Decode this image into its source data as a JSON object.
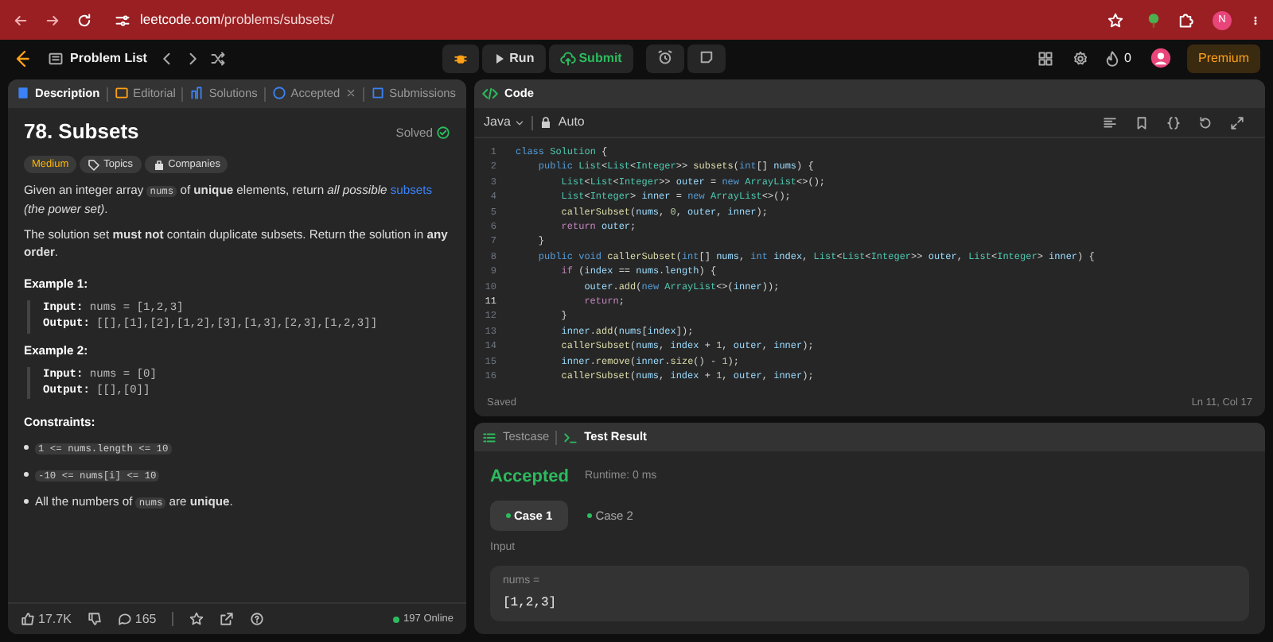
{
  "browser": {
    "url_domain": "leetcode.com",
    "url_path": "/problems/subsets/",
    "profile_initial": "N"
  },
  "nav": {
    "problem_list": "Problem List",
    "run": "Run",
    "submit": "Submit",
    "streak": "0",
    "premium": "Premium"
  },
  "description_tabs": [
    {
      "label": "Description",
      "selected": true,
      "closable": false
    },
    {
      "label": "Editorial",
      "selected": false,
      "closable": false
    },
    {
      "label": "Solutions",
      "selected": false,
      "closable": false
    },
    {
      "label": "Accepted",
      "selected": false,
      "closable": true
    },
    {
      "label": "Submissions",
      "selected": false,
      "closable": false
    }
  ],
  "problem": {
    "title": "78. Subsets",
    "status": "Solved",
    "difficulty": "Medium",
    "tags": [
      "Topics",
      "Companies"
    ],
    "paragraphs": [
      [
        {
          "kind": "text",
          "text": "Given an integer array "
        },
        {
          "kind": "code",
          "text": "nums"
        },
        {
          "kind": "text",
          "text": " of **unique** elements, return *all possible* "
        },
        {
          "kind": "link",
          "text": "subsets"
        },
        {
          "kind": "text",
          "text": " *(the power set)*."
        }
      ],
      [
        {
          "kind": "text",
          "text": "The solution set **must not** contain duplicate subsets. Return the solution in **any order**."
        }
      ]
    ],
    "examples": [
      {
        "title": "Example 1:",
        "lines": [
          {
            "label": "Input:",
            "value": "nums = [1,2,3]"
          },
          {
            "label": "Output:",
            "value": "[[],[1],[2],[1,2],[3],[1,3],[2,3],[1,2,3]]"
          }
        ]
      },
      {
        "title": "Example 2:",
        "lines": [
          {
            "label": "Input:",
            "value": "nums = [0]"
          },
          {
            "label": "Output:",
            "value": "[[],[0]]"
          }
        ]
      }
    ],
    "constraints_title": "Constraints:",
    "constraints": [
      [
        {
          "kind": "code",
          "text": "1 <= nums.length <= 10"
        }
      ],
      [
        {
          "kind": "code",
          "text": "-10 <= nums[i] <= 10"
        }
      ],
      [
        {
          "kind": "text",
          "text": "All the numbers of "
        },
        {
          "kind": "code",
          "text": "nums"
        },
        {
          "kind": "text",
          "text": " are **unique**."
        }
      ]
    ]
  },
  "footer": {
    "likes": "17.7K",
    "comments": "165",
    "online": "197 Online"
  },
  "code_panel": {
    "title": "Code",
    "language": "Java",
    "mode": "Auto",
    "status": "Saved",
    "cursor": "Ln 11, Col 17",
    "lines": [
      {
        "num": "1",
        "active": false,
        "tokens": [
          {
            "kind": "kw",
            "text": "class "
          },
          {
            "kind": "type",
            "text": "Solution"
          },
          {
            "kind": "p",
            "text": " {"
          }
        ]
      },
      {
        "num": "2",
        "active": false,
        "tokens": [
          {
            "kind": "kw",
            "text": "    public "
          },
          {
            "kind": "type",
            "text": "List"
          },
          {
            "kind": "p",
            "text": "<"
          },
          {
            "kind": "type",
            "text": "List"
          },
          {
            "kind": "p",
            "text": "<"
          },
          {
            "kind": "type",
            "text": "Integer"
          },
          {
            "kind": "p",
            "text": ">> "
          },
          {
            "kind": "fn",
            "text": "subsets"
          },
          {
            "kind": "p",
            "text": "("
          },
          {
            "kind": "kw",
            "text": "int"
          },
          {
            "kind": "p",
            "text": "[] "
          },
          {
            "kind": "var",
            "text": "nums"
          },
          {
            "kind": "p",
            "text": ") {"
          }
        ]
      },
      {
        "num": "3",
        "active": false,
        "tokens": [
          {
            "kind": "type",
            "text": "        List"
          },
          {
            "kind": "p",
            "text": "<"
          },
          {
            "kind": "type",
            "text": "List"
          },
          {
            "kind": "p",
            "text": "<"
          },
          {
            "kind": "type",
            "text": "Integer"
          },
          {
            "kind": "p",
            "text": ">> "
          },
          {
            "kind": "var",
            "text": "outer"
          },
          {
            "kind": "p",
            "text": " = "
          },
          {
            "kind": "kw",
            "text": "new "
          },
          {
            "kind": "type",
            "text": "ArrayList"
          },
          {
            "kind": "p",
            "text": "<>();"
          }
        ]
      },
      {
        "num": "4",
        "active": false,
        "tokens": [
          {
            "kind": "type",
            "text": "        List"
          },
          {
            "kind": "p",
            "text": "<"
          },
          {
            "kind": "type",
            "text": "Integer"
          },
          {
            "kind": "p",
            "text": "> "
          },
          {
            "kind": "var",
            "text": "inner"
          },
          {
            "kind": "p",
            "text": " = "
          },
          {
            "kind": "kw",
            "text": "new "
          },
          {
            "kind": "type",
            "text": "ArrayList"
          },
          {
            "kind": "p",
            "text": "<>();"
          }
        ]
      },
      {
        "num": "5",
        "active": false,
        "tokens": [
          {
            "kind": "fn",
            "text": "        callerSubset"
          },
          {
            "kind": "p",
            "text": "("
          },
          {
            "kind": "var",
            "text": "nums"
          },
          {
            "kind": "p",
            "text": ", "
          },
          {
            "kind": "num",
            "text": "0"
          },
          {
            "kind": "p",
            "text": ", "
          },
          {
            "kind": "var",
            "text": "outer"
          },
          {
            "kind": "p",
            "text": ", "
          },
          {
            "kind": "var",
            "text": "inner"
          },
          {
            "kind": "p",
            "text": ");"
          }
        ]
      },
      {
        "num": "6",
        "active": false,
        "tokens": [
          {
            "kind": "ctrl",
            "text": "        return "
          },
          {
            "kind": "var",
            "text": "outer"
          },
          {
            "kind": "p",
            "text": ";"
          }
        ]
      },
      {
        "num": "7",
        "active": false,
        "tokens": [
          {
            "kind": "p",
            "text": "    }"
          }
        ]
      },
      {
        "num": "8",
        "active": false,
        "tokens": [
          {
            "kind": "kw",
            "text": "    public void "
          },
          {
            "kind": "fn",
            "text": "callerSubset"
          },
          {
            "kind": "p",
            "text": "("
          },
          {
            "kind": "kw",
            "text": "int"
          },
          {
            "kind": "p",
            "text": "[] "
          },
          {
            "kind": "var",
            "text": "nums"
          },
          {
            "kind": "p",
            "text": ", "
          },
          {
            "kind": "kw",
            "text": "int "
          },
          {
            "kind": "var",
            "text": "index"
          },
          {
            "kind": "p",
            "text": ", "
          },
          {
            "kind": "type",
            "text": "List"
          },
          {
            "kind": "p",
            "text": "<"
          },
          {
            "kind": "type",
            "text": "List"
          },
          {
            "kind": "p",
            "text": "<"
          },
          {
            "kind": "type",
            "text": "Integer"
          },
          {
            "kind": "p",
            "text": ">> "
          },
          {
            "kind": "var",
            "text": "outer"
          },
          {
            "kind": "p",
            "text": ", "
          },
          {
            "kind": "type",
            "text": "List"
          },
          {
            "kind": "p",
            "text": "<"
          },
          {
            "kind": "type",
            "text": "Integer"
          },
          {
            "kind": "p",
            "text": "> "
          },
          {
            "kind": "var",
            "text": "inner"
          },
          {
            "kind": "p",
            "text": ") {"
          }
        ]
      },
      {
        "num": "9",
        "active": false,
        "tokens": [
          {
            "kind": "ctrl",
            "text": "        if"
          },
          {
            "kind": "p",
            "text": " ("
          },
          {
            "kind": "var",
            "text": "index"
          },
          {
            "kind": "p",
            "text": " == "
          },
          {
            "kind": "var",
            "text": "nums"
          },
          {
            "kind": "p",
            "text": "."
          },
          {
            "kind": "var",
            "text": "length"
          },
          {
            "kind": "p",
            "text": ") {"
          }
        ]
      },
      {
        "num": "10",
        "active": false,
        "tokens": [
          {
            "kind": "var",
            "text": "            outer"
          },
          {
            "kind": "p",
            "text": "."
          },
          {
            "kind": "fn",
            "text": "add"
          },
          {
            "kind": "p",
            "text": "("
          },
          {
            "kind": "kw",
            "text": "new "
          },
          {
            "kind": "type",
            "text": "ArrayList"
          },
          {
            "kind": "p",
            "text": "<>("
          },
          {
            "kind": "var",
            "text": "inner"
          },
          {
            "kind": "p",
            "text": "));"
          }
        ]
      },
      {
        "num": "11",
        "active": true,
        "tokens": [
          {
            "kind": "ctrl",
            "text": "            return"
          },
          {
            "kind": "p",
            "text": ";"
          }
        ]
      },
      {
        "num": "12",
        "active": false,
        "tokens": [
          {
            "kind": "p",
            "text": "        }"
          }
        ]
      },
      {
        "num": "13",
        "active": false,
        "tokens": [
          {
            "kind": "var",
            "text": "        inner"
          },
          {
            "kind": "p",
            "text": "."
          },
          {
            "kind": "fn",
            "text": "add"
          },
          {
            "kind": "p",
            "text": "("
          },
          {
            "kind": "var",
            "text": "nums"
          },
          {
            "kind": "p",
            "text": "["
          },
          {
            "kind": "var",
            "text": "index"
          },
          {
            "kind": "p",
            "text": "]);"
          }
        ]
      },
      {
        "num": "14",
        "active": false,
        "tokens": [
          {
            "kind": "fn",
            "text": "        callerSubset"
          },
          {
            "kind": "p",
            "text": "("
          },
          {
            "kind": "var",
            "text": "nums"
          },
          {
            "kind": "p",
            "text": ", "
          },
          {
            "kind": "var",
            "text": "index"
          },
          {
            "kind": "p",
            "text": " + "
          },
          {
            "kind": "num",
            "text": "1"
          },
          {
            "kind": "p",
            "text": ", "
          },
          {
            "kind": "var",
            "text": "outer"
          },
          {
            "kind": "p",
            "text": ", "
          },
          {
            "kind": "var",
            "text": "inner"
          },
          {
            "kind": "p",
            "text": ");"
          }
        ]
      },
      {
        "num": "15",
        "active": false,
        "tokens": [
          {
            "kind": "var",
            "text": "        inner"
          },
          {
            "kind": "p",
            "text": "."
          },
          {
            "kind": "fn",
            "text": "remove"
          },
          {
            "kind": "p",
            "text": "("
          },
          {
            "kind": "var",
            "text": "inner"
          },
          {
            "kind": "p",
            "text": "."
          },
          {
            "kind": "fn",
            "text": "size"
          },
          {
            "kind": "p",
            "text": "() - "
          },
          {
            "kind": "num",
            "text": "1"
          },
          {
            "kind": "p",
            "text": ");"
          }
        ]
      },
      {
        "num": "16",
        "active": false,
        "tokens": [
          {
            "kind": "fn",
            "text": "        callerSubset"
          },
          {
            "kind": "p",
            "text": "("
          },
          {
            "kind": "var",
            "text": "nums"
          },
          {
            "kind": "p",
            "text": ", "
          },
          {
            "kind": "var",
            "text": "index"
          },
          {
            "kind": "p",
            "text": " + "
          },
          {
            "kind": "num",
            "text": "1"
          },
          {
            "kind": "p",
            "text": ", "
          },
          {
            "kind": "var",
            "text": "outer"
          },
          {
            "kind": "p",
            "text": ", "
          },
          {
            "kind": "var",
            "text": "inner"
          },
          {
            "kind": "p",
            "text": ");"
          }
        ]
      }
    ]
  },
  "result_tabs": [
    {
      "label": "Testcase",
      "selected": false
    },
    {
      "label": "Test Result",
      "selected": true
    }
  ],
  "result": {
    "verdict": "Accepted",
    "runtime": "Runtime: 0 ms",
    "cases": [
      {
        "label": "Case 1",
        "selected": true
      },
      {
        "label": "Case 2",
        "selected": false
      }
    ],
    "input_label": "Input",
    "var_label": "nums =",
    "var_value": "[1,2,3]"
  }
}
